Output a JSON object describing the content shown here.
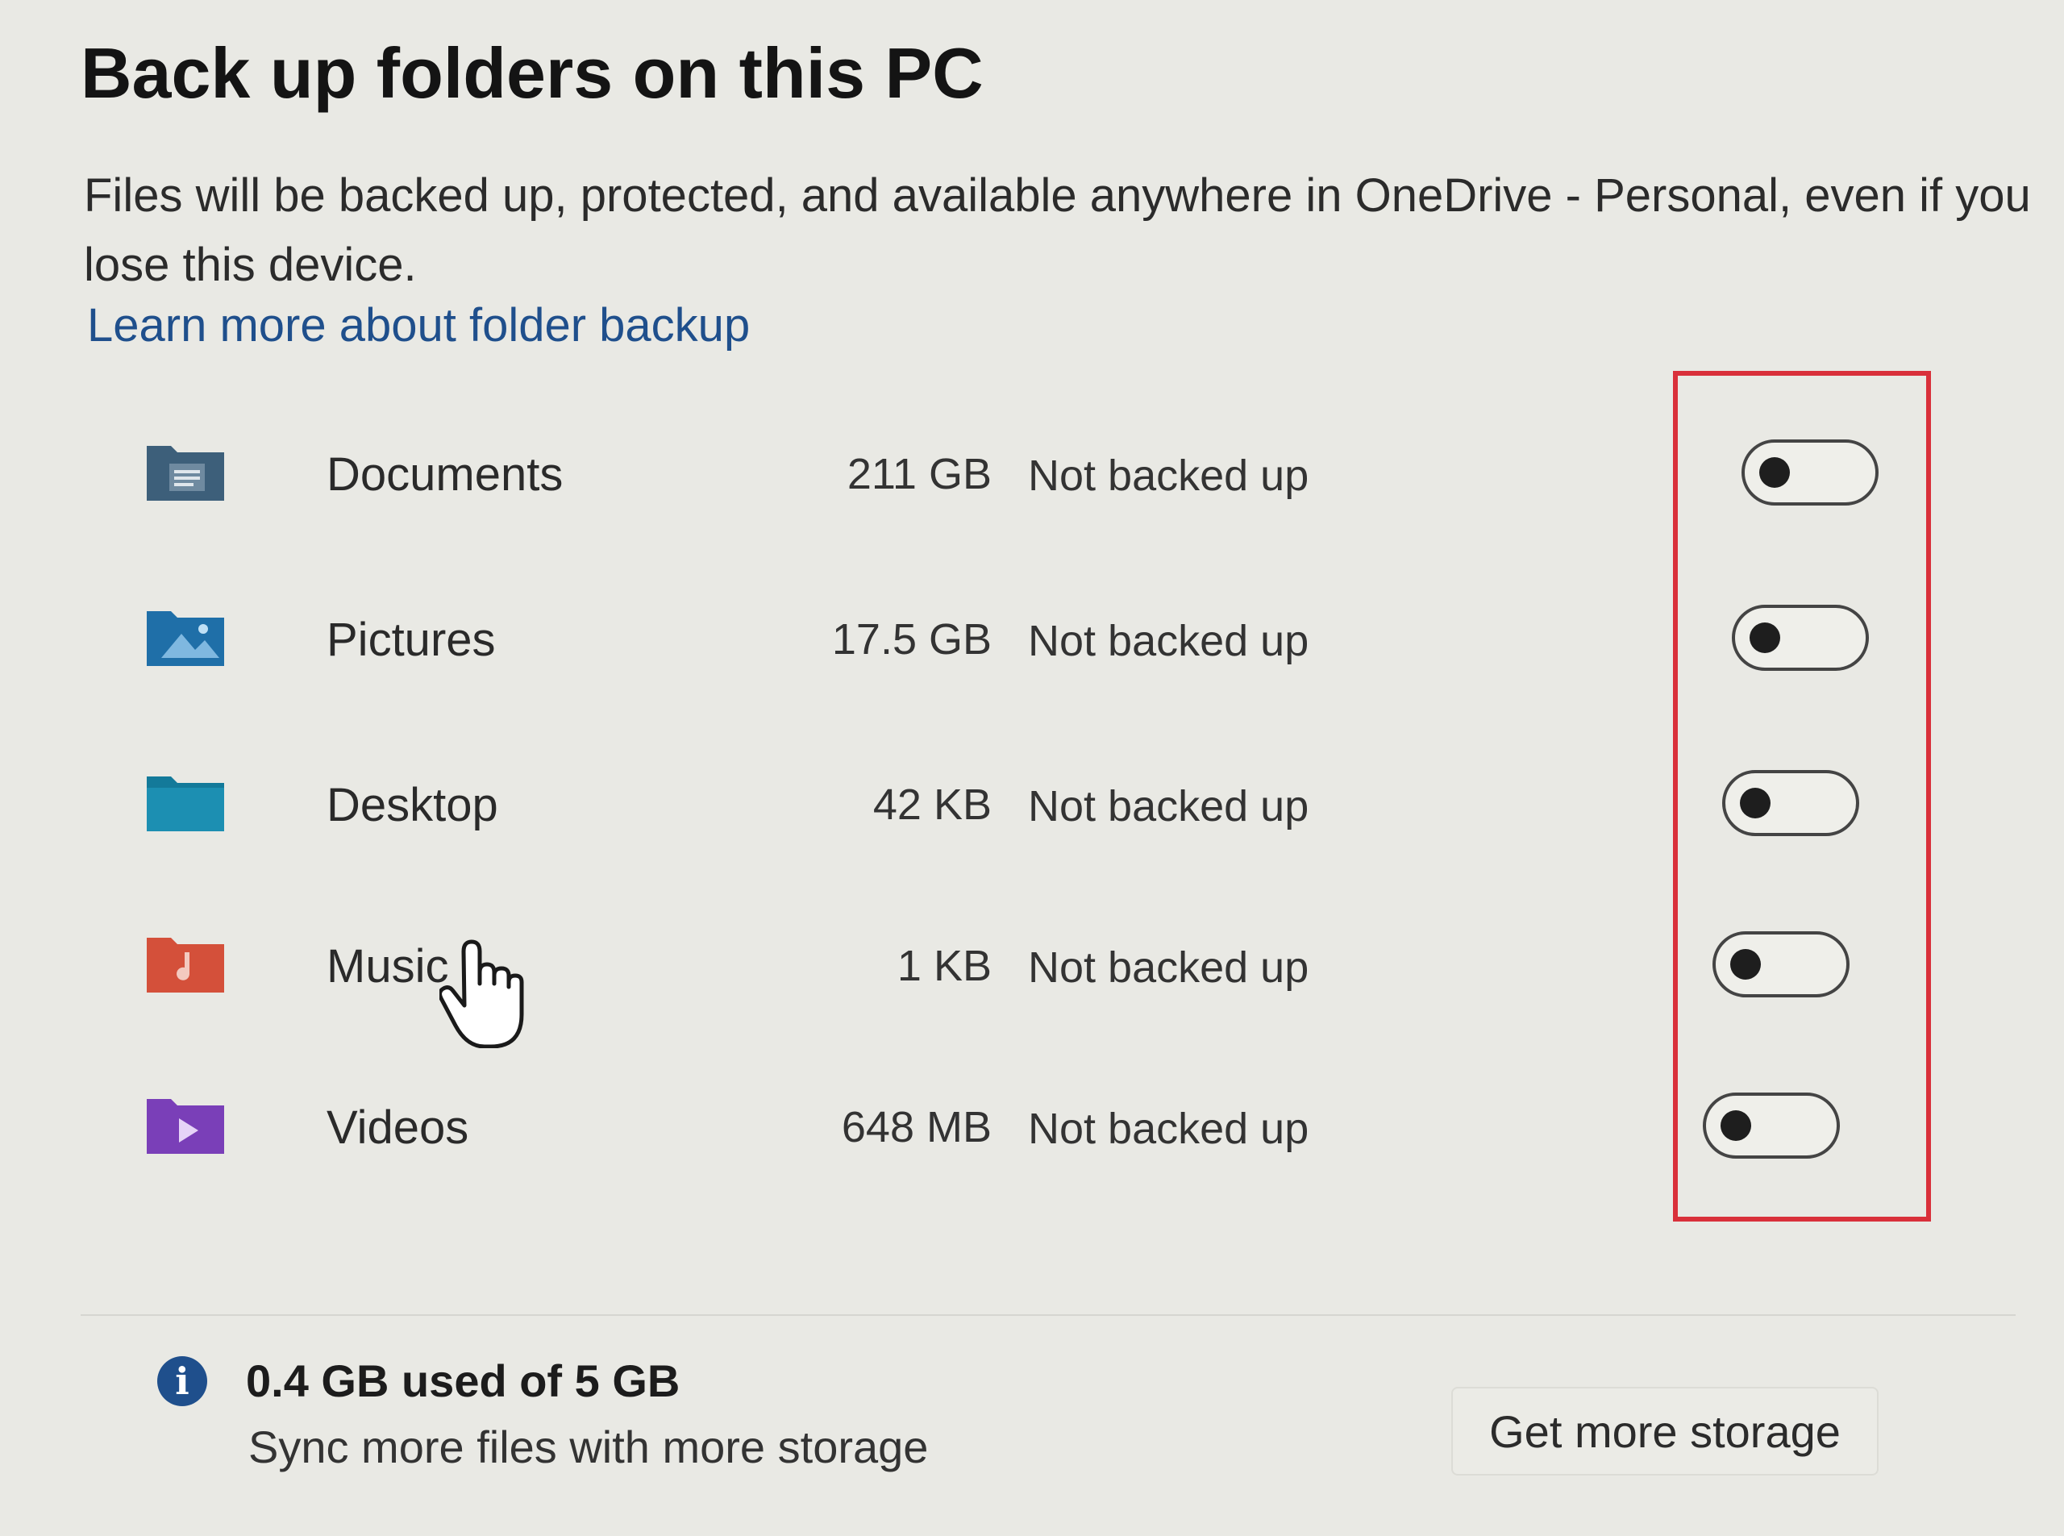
{
  "header": {
    "title": "Back up folders on this PC",
    "description": "Files will be backed up, protected, and available anywhere in OneDrive - Personal, even if you lose this device.",
    "learn_more_link": "Learn more about folder backup"
  },
  "folders": [
    {
      "name": "Documents",
      "size": "211 GB",
      "status": "Not backed up",
      "icon": "documents-folder-icon",
      "color": "#3d5f7a",
      "backup_enabled": false
    },
    {
      "name": "Pictures",
      "size": "17.5 GB",
      "status": "Not backed up",
      "icon": "pictures-folder-icon",
      "color": "#1f6fa8",
      "backup_enabled": false
    },
    {
      "name": "Desktop",
      "size": "42 KB",
      "status": "Not backed up",
      "icon": "desktop-folder-icon",
      "color": "#137a9a",
      "backup_enabled": false
    },
    {
      "name": "Music",
      "size": "1 KB",
      "status": "Not backed up",
      "icon": "music-folder-icon",
      "color": "#d4503a",
      "backup_enabled": false
    },
    {
      "name": "Videos",
      "size": "648 MB",
      "status": "Not backed up",
      "icon": "videos-folder-icon",
      "color": "#7a3fb8",
      "backup_enabled": false
    }
  ],
  "storage": {
    "used_text": "0.4 GB used of 5 GB",
    "subtext": "Sync more files with more storage",
    "button_label": "Get more storage",
    "icon": "info-icon"
  },
  "colors": {
    "link": "#1f4f8c",
    "highlight_border": "#d9303a",
    "background": "#e9e9e4"
  }
}
